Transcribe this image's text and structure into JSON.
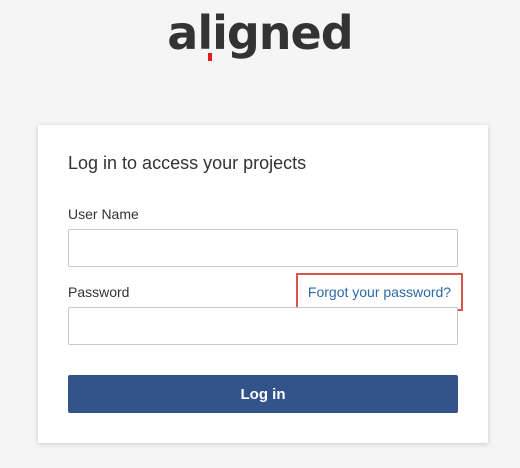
{
  "logo": {
    "text": "aligned"
  },
  "login": {
    "title": "Log in to access your projects",
    "username_label": "User Name",
    "username_value": "",
    "password_label": "Password",
    "password_value": "",
    "forgot_password": "Forgot your password?",
    "submit": "Log in"
  },
  "colors": {
    "button": "#33548a",
    "link": "#2a6aa8",
    "highlight_border": "#d9534f",
    "logo_accent": "#e31b23"
  }
}
